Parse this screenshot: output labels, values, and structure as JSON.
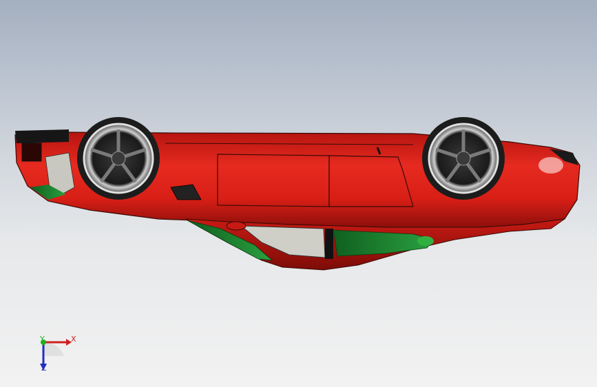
{
  "viewport": {
    "background_top": "#a4afbf",
    "background_bottom": "#f2f2f2"
  },
  "model": {
    "body_color": "#d81f16",
    "body_highlight": "#f24a3f",
    "accent_green": "#1a7a2a",
    "glass_color": "#c9c9c2",
    "wheel_color": "#2a2a2a",
    "rim_color": "#9a9a9a"
  },
  "triad": {
    "x_label": "X",
    "y_label": "Y",
    "z_label": "Z",
    "x_color": "#d02020",
    "y_color": "#20b020",
    "z_color": "#2030c0"
  }
}
